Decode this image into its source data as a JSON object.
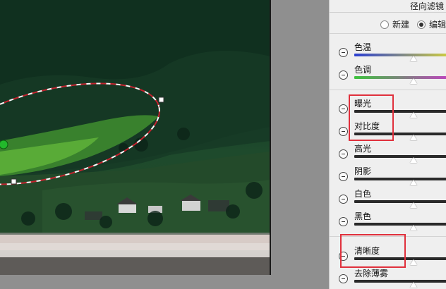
{
  "panel": {
    "title": "径向滤镜",
    "modes": [
      {
        "label": "新建",
        "selected": false
      },
      {
        "label": "编辑",
        "selected": true
      }
    ]
  },
  "sliders": [
    {
      "label": "色温",
      "track": "temp",
      "value_pct": 60
    },
    {
      "label": "色调",
      "track": "tint",
      "value_pct": 60
    },
    {
      "label": "曝光",
      "track": "dark",
      "value_pct": 60
    },
    {
      "label": "对比度",
      "track": "dark",
      "value_pct": 60
    },
    {
      "label": "高光",
      "track": "dark",
      "value_pct": 60
    },
    {
      "label": "阴影",
      "track": "dark",
      "value_pct": 60
    },
    {
      "label": "白色",
      "track": "dark",
      "value_pct": 60
    },
    {
      "label": "黑色",
      "track": "dark",
      "value_pct": 60
    },
    {
      "label": "清晰度",
      "track": "dark",
      "value_pct": 60
    },
    {
      "label": "去除薄雾",
      "track": "dark",
      "value_pct": 60
    }
  ],
  "colors": {
    "highlight": "#e0303c",
    "temp_track": "linear-gradient(90deg,#2b3fd2,#d6d43a)",
    "tint_track": "linear-gradient(90deg,#3ec33e,#c43ec4)",
    "dark_track": "#2a2a2a"
  }
}
